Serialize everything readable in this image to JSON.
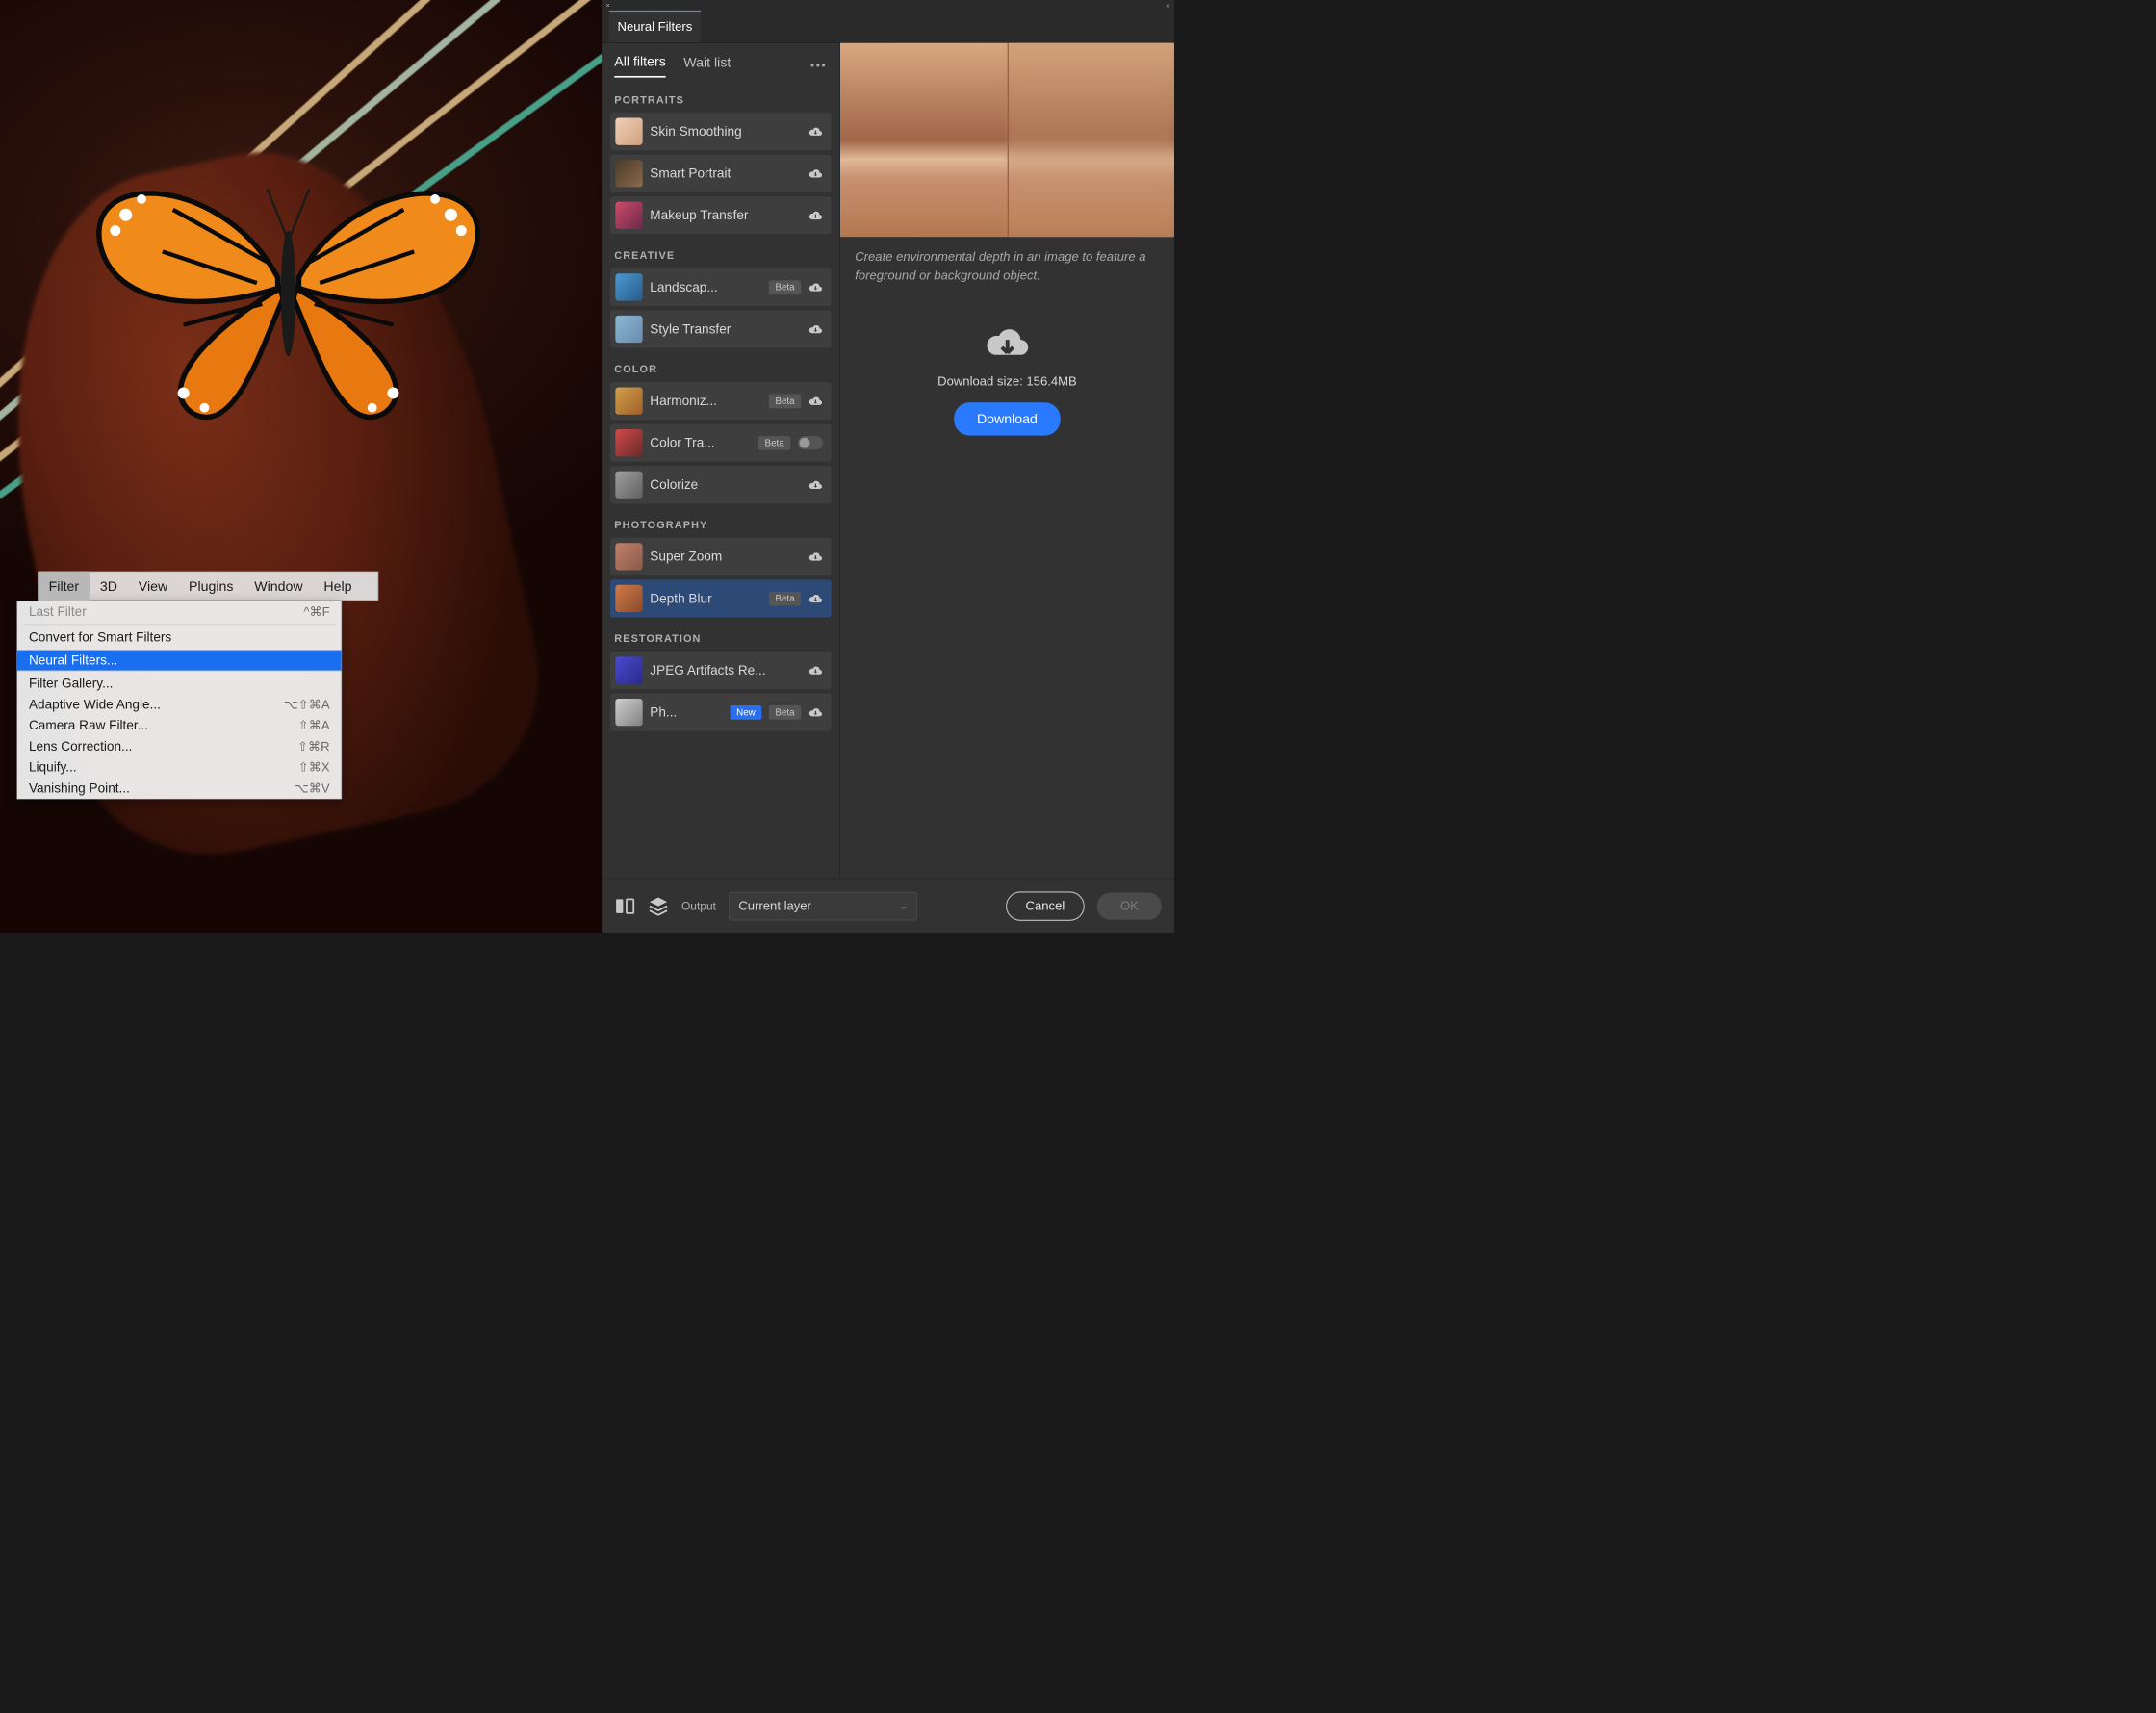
{
  "menubar": {
    "items": [
      "Filter",
      "3D",
      "View",
      "Plugins",
      "Window",
      "Help"
    ],
    "active": "Filter"
  },
  "dropdown": {
    "lastFilter": {
      "label": "Last Filter",
      "shortcut": "^⌘F"
    },
    "convertSmart": {
      "label": "Convert for Smart Filters"
    },
    "neuralFilters": {
      "label": "Neural Filters..."
    },
    "filterGallery": {
      "label": "Filter Gallery..."
    },
    "adaptiveWide": {
      "label": "Adaptive Wide Angle...",
      "shortcut": "⌥⇧⌘A"
    },
    "cameraRaw": {
      "label": "Camera Raw Filter...",
      "shortcut": "⇧⌘A"
    },
    "lensCorrection": {
      "label": "Lens Correction...",
      "shortcut": "⇧⌘R"
    },
    "liquify": {
      "label": "Liquify...",
      "shortcut": "⇧⌘X"
    },
    "vanishing": {
      "label": "Vanishing Point...",
      "shortcut": "⌥⌘V"
    }
  },
  "panel": {
    "title": "Neural Filters",
    "subtabs": {
      "all": "All filters",
      "wait": "Wait list"
    },
    "categories": {
      "portraits": "Portraits",
      "creative": "Creative",
      "color": "Color",
      "photography": "Photography",
      "restoration": "Restoration"
    },
    "filters": {
      "skinSmoothing": {
        "label": "Skin Smoothing"
      },
      "smartPortrait": {
        "label": "Smart Portrait"
      },
      "makeupTransfer": {
        "label": "Makeup Transfer"
      },
      "landscapeMixer": {
        "label": "Landscap...",
        "badge": "Beta"
      },
      "styleTransfer": {
        "label": "Style Transfer"
      },
      "harmonization": {
        "label": "Harmoniz...",
        "badge": "Beta"
      },
      "colorTransfer": {
        "label": "Color Tra...",
        "badge": "Beta"
      },
      "colorize": {
        "label": "Colorize"
      },
      "superZoom": {
        "label": "Super Zoom"
      },
      "depthBlur": {
        "label": "Depth Blur",
        "badge": "Beta"
      },
      "jpegArtifacts": {
        "label": "JPEG Artifacts Re..."
      },
      "photoRestoration": {
        "label": "Ph...",
        "new": "New",
        "badge": "Beta"
      }
    },
    "detail": {
      "description": "Create environmental depth in an image to feature a foreground or background object.",
      "downloadLabel": "Download size: 156.4MB",
      "downloadButton": "Download"
    },
    "footer": {
      "outputLabel": "Output",
      "outputValue": "Current layer",
      "cancel": "Cancel",
      "ok": "OK"
    }
  }
}
